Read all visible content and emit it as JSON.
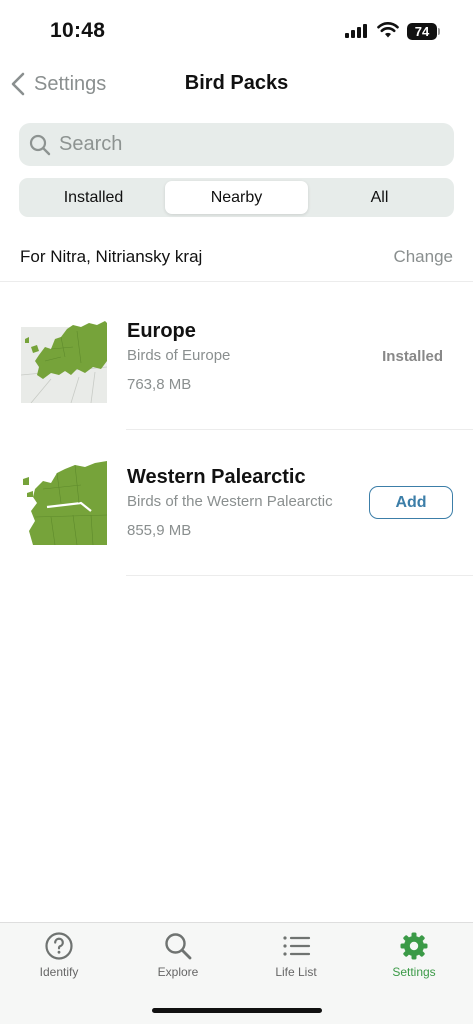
{
  "status_bar": {
    "time": "10:48",
    "battery": "74"
  },
  "nav": {
    "back_label": "Settings",
    "title": "Bird Packs"
  },
  "search": {
    "placeholder": "Search"
  },
  "segments": [
    {
      "label": "Installed",
      "selected": false
    },
    {
      "label": "Nearby",
      "selected": true
    },
    {
      "label": "All",
      "selected": false
    }
  ],
  "location": {
    "text": "For Nitra, Nitriansky kraj",
    "change_label": "Change"
  },
  "packs": [
    {
      "title": "Europe",
      "subtitle": "Birds of Europe",
      "size": "763,8 MB",
      "status": "Installed",
      "map_icon": "europe-map"
    },
    {
      "title": "Western Palearctic",
      "subtitle": "Birds of the Western Palearctic",
      "size": "855,9 MB",
      "action": "Add",
      "map_icon": "western-palearctic-map"
    }
  ],
  "tabs": [
    {
      "label": "Identify",
      "icon": "question-circle-icon",
      "active": false
    },
    {
      "label": "Explore",
      "icon": "magnifier-icon",
      "active": false
    },
    {
      "label": "Life List",
      "icon": "list-icon",
      "active": false
    },
    {
      "label": "Settings",
      "icon": "gear-icon",
      "active": true
    }
  ],
  "colors": {
    "accent_green": "#3b9a47",
    "link_blue": "#3c7ea8",
    "map_green": "#76a33a"
  }
}
